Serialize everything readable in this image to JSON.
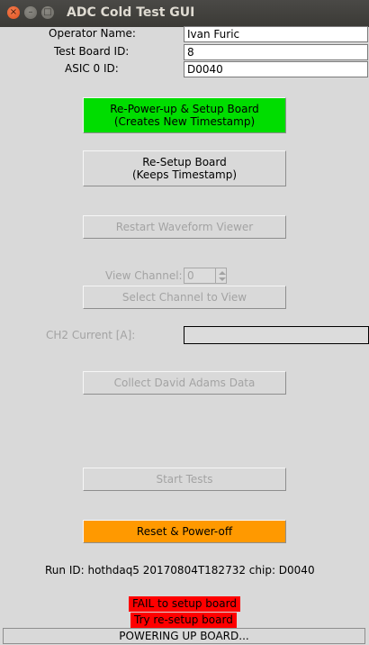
{
  "window": {
    "title": "ADC Cold Test GUI",
    "close_glyph": "×",
    "min_glyph": "–",
    "max_glyph": "□"
  },
  "form": {
    "operator_label": "Operator Name:",
    "operator_value": "Ivan Furic",
    "board_label": "Test Board ID:",
    "board_value": "8",
    "asic_label": "ASIC 0 ID:",
    "asic_value": "D0040"
  },
  "buttons": {
    "repower": "Re-Power-up & Setup Board\n(Creates New Timestamp)",
    "resetup": "Re-Setup Board\n(Keeps Timestamp)",
    "restart_viewer": "Restart Waveform Viewer",
    "select_channel": "Select Channel to View",
    "collect": "Collect David Adams Data",
    "start_tests": "Start Tests",
    "reset_poweroff": "Reset & Power-off"
  },
  "view_channel": {
    "label": "View Channel:",
    "value": "0"
  },
  "current": {
    "label": "CH2 Current [A]:",
    "value": ""
  },
  "run_id": "Run ID: hothdaq5 20170804T182732 chip: D0040",
  "messages": {
    "fail": "FAIL to setup board",
    "retry": "Try re-setup board"
  },
  "status": "POWERING UP BOARD...",
  "colors": {
    "green_button": "#00dd00",
    "orange_button": "#ff9900",
    "fail_bg": "#ff0000"
  }
}
